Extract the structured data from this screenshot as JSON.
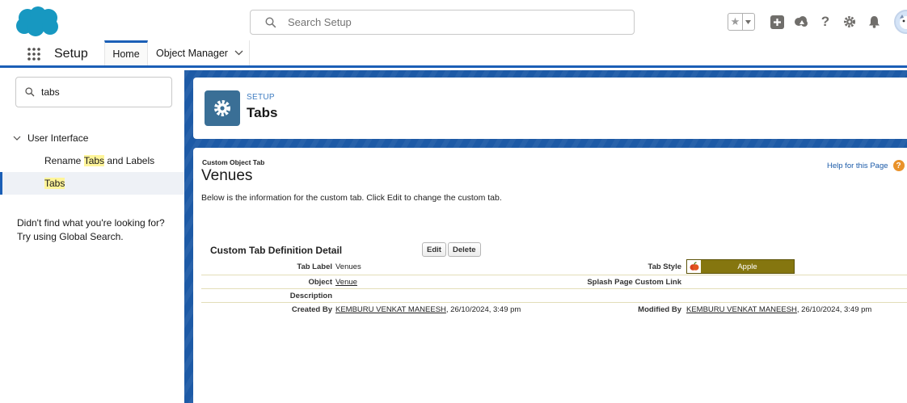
{
  "header": {
    "search_placeholder": "Search Setup"
  },
  "context_bar": {
    "app_name": "Setup",
    "tabs": [
      {
        "label": "Home"
      },
      {
        "label": "Object Manager"
      }
    ]
  },
  "sidebar": {
    "quick_find_value": "tabs",
    "section": "User Interface",
    "items": [
      {
        "pre": "Rename ",
        "match": "Tabs",
        "post": " and Labels"
      },
      {
        "pre": "",
        "match": "Tabs",
        "post": ""
      }
    ],
    "not_found": "Didn't find what you're looking for? Try using Global Search."
  },
  "page_header": {
    "eyebrow": "SETUP",
    "title": "Tabs"
  },
  "detail": {
    "object_type": "Custom Object Tab",
    "object_name": "Venues",
    "help_link": "Help for this Page",
    "description": "Below is the information for the custom tab. Click Edit to change the custom tab.",
    "section_title": "Custom Tab Definition Detail",
    "edit_label": "Edit",
    "delete_label": "Delete",
    "fields": {
      "tab_label": {
        "label": "Tab Label",
        "value": "Venues"
      },
      "tab_style": {
        "label": "Tab Style",
        "value": "Apple"
      },
      "object": {
        "label": "Object",
        "value": "Venue"
      },
      "splash": {
        "label": "Splash Page Custom Link",
        "value": ""
      },
      "description": {
        "label": "Description",
        "value": ""
      },
      "created_by": {
        "label": "Created By",
        "user": "KEMBURU VENKAT MANEESH",
        "date": ", 26/10/2024, 3:49 pm"
      },
      "modified_by": {
        "label": "Modified By",
        "user": "KEMBURU VENKAT MANEESH",
        "date": ", 26/10/2024, 3:49 pm"
      }
    }
  },
  "colors": {
    "brand_blue": "#1b5fb6",
    "logo_blue": "#1798c1",
    "tab_style_bg": "#85760f",
    "help_orange": "#e9922a",
    "highlight": "#fff59a"
  },
  "icons": [
    "salesforce-cloud-logo",
    "search-icon",
    "star-icon",
    "chevron-down-icon",
    "plus-icon",
    "trailhead-icon",
    "help-icon",
    "gear-icon",
    "bell-icon",
    "avatar",
    "app-launcher-icon",
    "apple-icon"
  ]
}
